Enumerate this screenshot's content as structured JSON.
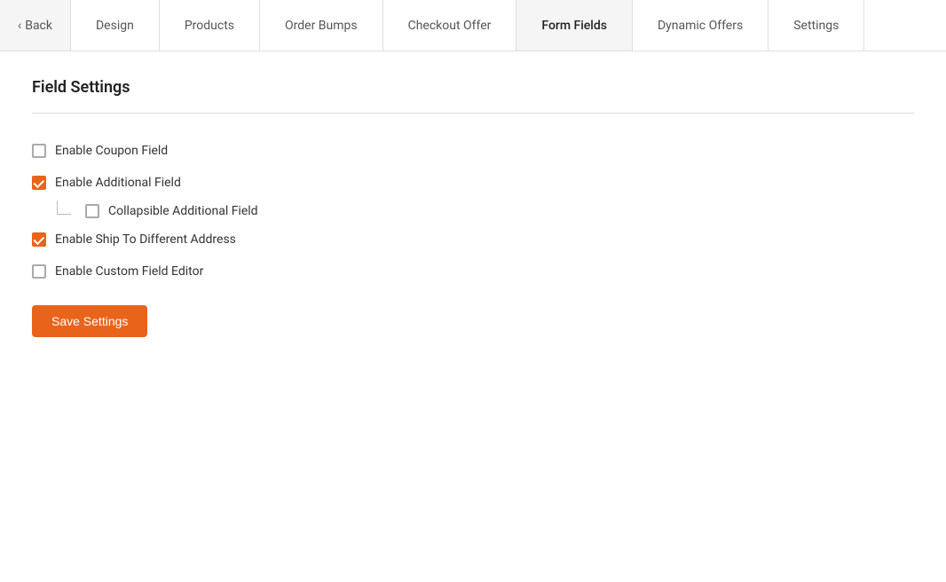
{
  "nav": {
    "back_label": "Back",
    "tabs": [
      {
        "id": "design",
        "label": "Design",
        "active": false
      },
      {
        "id": "products",
        "label": "Products",
        "active": false
      },
      {
        "id": "order-bumps",
        "label": "Order Bumps",
        "active": false
      },
      {
        "id": "checkout-offer",
        "label": "Checkout Offer",
        "active": false
      },
      {
        "id": "form-fields",
        "label": "Form Fields",
        "active": true
      },
      {
        "id": "dynamic-offers",
        "label": "Dynamic Offers",
        "active": false
      },
      {
        "id": "settings",
        "label": "Settings",
        "active": false
      }
    ]
  },
  "field_settings": {
    "title": "Field Settings",
    "fields": [
      {
        "id": "enable-coupon-field",
        "label": "Enable Coupon Field",
        "checked": false,
        "nested": false
      },
      {
        "id": "enable-additional-field",
        "label": "Enable Additional Field",
        "checked": true,
        "nested": false
      },
      {
        "id": "collapsible-additional-field",
        "label": "Collapsible Additional Field",
        "checked": false,
        "nested": true
      },
      {
        "id": "enable-ship-to-different-address",
        "label": "Enable Ship To Different Address",
        "checked": true,
        "nested": false
      },
      {
        "id": "enable-custom-field-editor",
        "label": "Enable Custom Field Editor",
        "checked": false,
        "nested": false
      }
    ],
    "save_button_label": "Save Settings"
  }
}
